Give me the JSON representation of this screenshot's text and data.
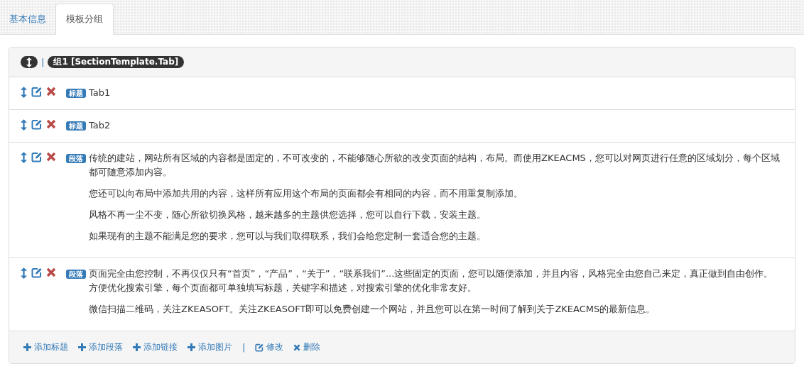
{
  "tabs": [
    {
      "label": "基本信息",
      "selected": false
    },
    {
      "label": "模板分组",
      "selected": true
    }
  ],
  "group": {
    "separator": "|",
    "name": "组1 [SectionTemplate.Tab]",
    "items": [
      {
        "kind": "title",
        "badge": "标题",
        "text": "Tab1"
      },
      {
        "kind": "title",
        "badge": "标题",
        "text": "Tab2"
      },
      {
        "kind": "paragraph",
        "badge": "段落",
        "paragraphs": [
          [
            "传统的建站，网站所有区域的内容都是固定的，不可改变的，不能够随心所欲的改变页面的结构，布局。而使用ZKEACMS，您可以对网页进行任意的区域划分，每个区域都可随意添加内容。"
          ],
          [
            "您还可以向布局中添加共用的内容，这样所有应用这个布局的页面都会有相同的内容，而不用重复制添加。"
          ],
          [
            "风格不再一尘不变，随心所欲切换风格，越来越多的主题供您选择，您可以自行下载，安装主题。"
          ],
          [
            "如果现有的主题不能满足您的要求，您可以与我们取得联系，我们会给您定制一套适合您的主题。"
          ]
        ]
      },
      {
        "kind": "paragraph",
        "badge": "段落",
        "paragraphs": [
          [
            "页面完全由您控制，不再仅仅只有“首页”，“产品”，“关于”，“联系我们”...这些固定的页面，您可以随便添加，并且内容，风格完全由您自己来定，真正做到自由创作。",
            "方便优化搜索引擎，每个页面都可单独填写标题，关键字和描述，对搜索引擎的优化非常友好。"
          ],
          [
            "微信扫描二维码，关注ZKEASOFT。关注ZKEASOFT即可以免费创建一个网站，并且您可以在第一时间了解到关于ZKEACMS的最新信息。"
          ]
        ]
      }
    ],
    "footer": [
      {
        "kind": "add",
        "label": "添加标题"
      },
      {
        "kind": "add",
        "label": "添加段落"
      },
      {
        "kind": "add",
        "label": "添加链接"
      },
      {
        "kind": "add",
        "label": "添加图片"
      },
      {
        "kind": "separator",
        "label": "|"
      },
      {
        "kind": "edit",
        "label": "修改"
      },
      {
        "kind": "delete",
        "label": "删除"
      }
    ]
  }
}
